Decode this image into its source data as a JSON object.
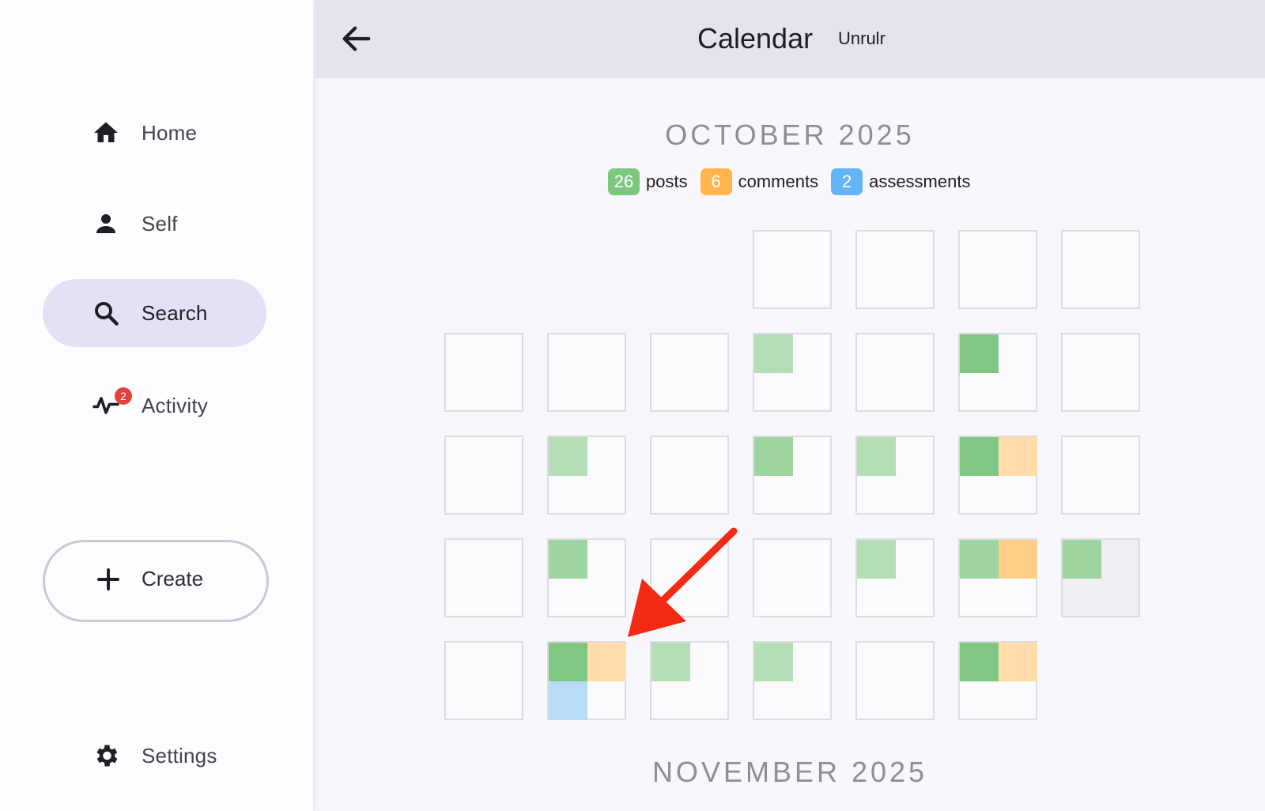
{
  "sidebar": {
    "items": [
      {
        "label": "Home",
        "icon": "home-icon"
      },
      {
        "label": "Self",
        "icon": "person-icon"
      },
      {
        "label": "Search",
        "icon": "search-icon",
        "active": true
      },
      {
        "label": "Activity",
        "icon": "activity-icon",
        "badge": "2"
      }
    ],
    "create_label": "Create",
    "settings_label": "Settings"
  },
  "header": {
    "title": "Calendar",
    "subtitle": "Unrulr"
  },
  "calendar": {
    "month": "OCTOBER 2025",
    "next_month": "NOVEMBER 2025",
    "legend": {
      "posts_count": "26",
      "posts_label": "posts",
      "comments_count": "6",
      "comments_label": "comments",
      "assessments_count": "2",
      "assessments_label": "assessments"
    },
    "colors": {
      "posts_strong": "#81c784",
      "posts_medium": "#9dd4a0",
      "posts_light": "#b4dfb6",
      "comments_light": "#ffdca8",
      "comments_medium": "#ffcf88",
      "assessments_light": "#b8dcf8",
      "posts_chip": "#7ec77f",
      "comments_chip": "#ffb54d",
      "assessments_chip": "#64b5f6"
    },
    "days": [
      {
        "day": 1,
        "cells": []
      },
      {
        "day": 2,
        "cells": []
      },
      {
        "day": 3,
        "cells": []
      },
      {
        "day": 4,
        "cells": []
      },
      {
        "day": 5,
        "cells": []
      },
      {
        "day": 6,
        "cells": []
      },
      {
        "day": 7,
        "cells": []
      },
      {
        "day": 8,
        "cells": [
          "posts_light"
        ]
      },
      {
        "day": 9,
        "cells": []
      },
      {
        "day": 10,
        "cells": [
          "posts_strong"
        ]
      },
      {
        "day": 11,
        "cells": []
      },
      {
        "day": 12,
        "cells": []
      },
      {
        "day": 13,
        "cells": [
          "posts_light"
        ]
      },
      {
        "day": 14,
        "cells": []
      },
      {
        "day": 15,
        "cells": [
          "posts_medium"
        ]
      },
      {
        "day": 16,
        "cells": [
          "posts_light"
        ]
      },
      {
        "day": 17,
        "cells": [
          "posts_strong",
          "comments_light"
        ]
      },
      {
        "day": 18,
        "cells": []
      },
      {
        "day": 19,
        "cells": []
      },
      {
        "day": 20,
        "cells": [
          "posts_medium"
        ]
      },
      {
        "day": 21,
        "cells": []
      },
      {
        "day": 22,
        "cells": []
      },
      {
        "day": 23,
        "cells": [
          "posts_light"
        ]
      },
      {
        "day": 24,
        "cells": [
          "posts_medium",
          "comments_medium"
        ]
      },
      {
        "day": 25,
        "cells": [
          "posts_medium"
        ],
        "future": true
      },
      {
        "day": 26,
        "cells": []
      },
      {
        "day": 27,
        "cells": [
          "posts_strong",
          "comments_light",
          "assessments_light"
        ]
      },
      {
        "day": 28,
        "cells": [
          "posts_light"
        ]
      },
      {
        "day": 29,
        "cells": [
          "posts_light"
        ]
      },
      {
        "day": 30,
        "cells": []
      },
      {
        "day": 31,
        "cells": [
          "posts_strong",
          "comments_light"
        ]
      }
    ]
  },
  "annotation": {
    "arrow_color": "#f32a14"
  }
}
